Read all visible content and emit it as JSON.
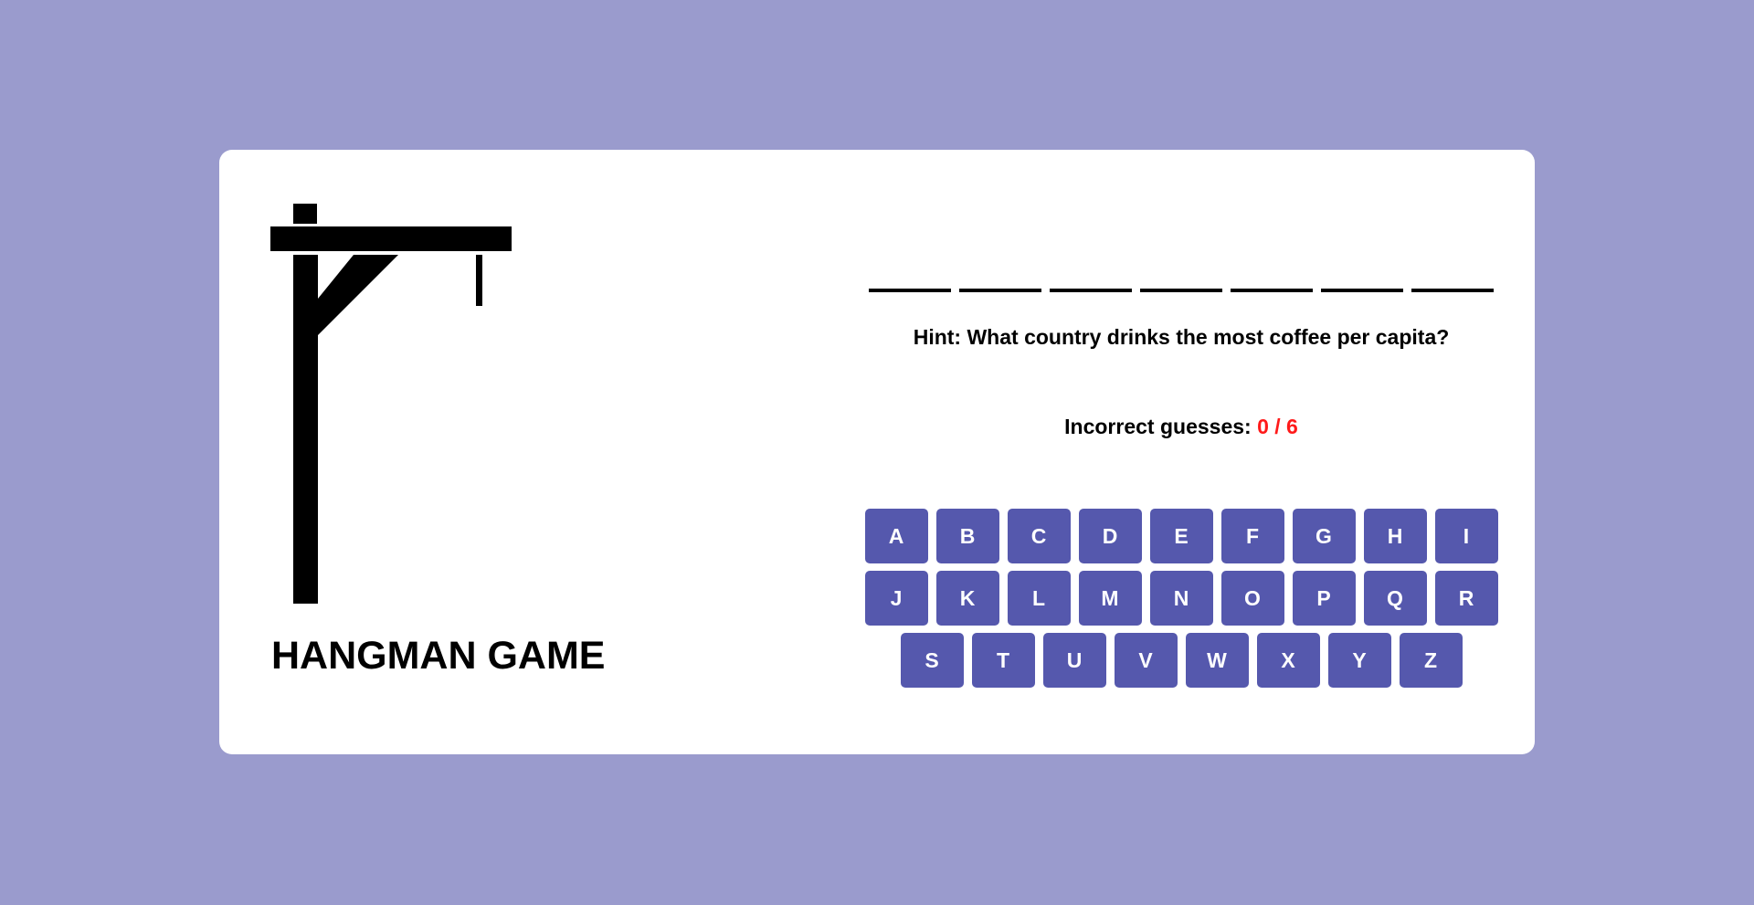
{
  "game": {
    "title": "HANGMAN GAME",
    "word_slots": [
      "",
      "",
      "",
      "",
      "",
      "",
      ""
    ],
    "hint_label": "Hint:",
    "hint_text": "What country drinks the most coffee per capita?",
    "incorrect_label": "Incorrect guesses:",
    "incorrect_count": "0",
    "separator": "/",
    "max_guesses": "6"
  },
  "keyboard": {
    "rows": [
      [
        "A",
        "B",
        "C",
        "D",
        "E",
        "F",
        "G",
        "H",
        "I"
      ],
      [
        "J",
        "K",
        "L",
        "M",
        "N",
        "O",
        "P",
        "Q",
        "R"
      ],
      [
        "S",
        "T",
        "U",
        "V",
        "W",
        "X",
        "Y",
        "Z"
      ]
    ]
  },
  "colors": {
    "background": "#9a9bcd",
    "card": "#ffffff",
    "key": "#5558ad",
    "key_text": "#ffffff",
    "guess_count": "#ff1a1a"
  }
}
